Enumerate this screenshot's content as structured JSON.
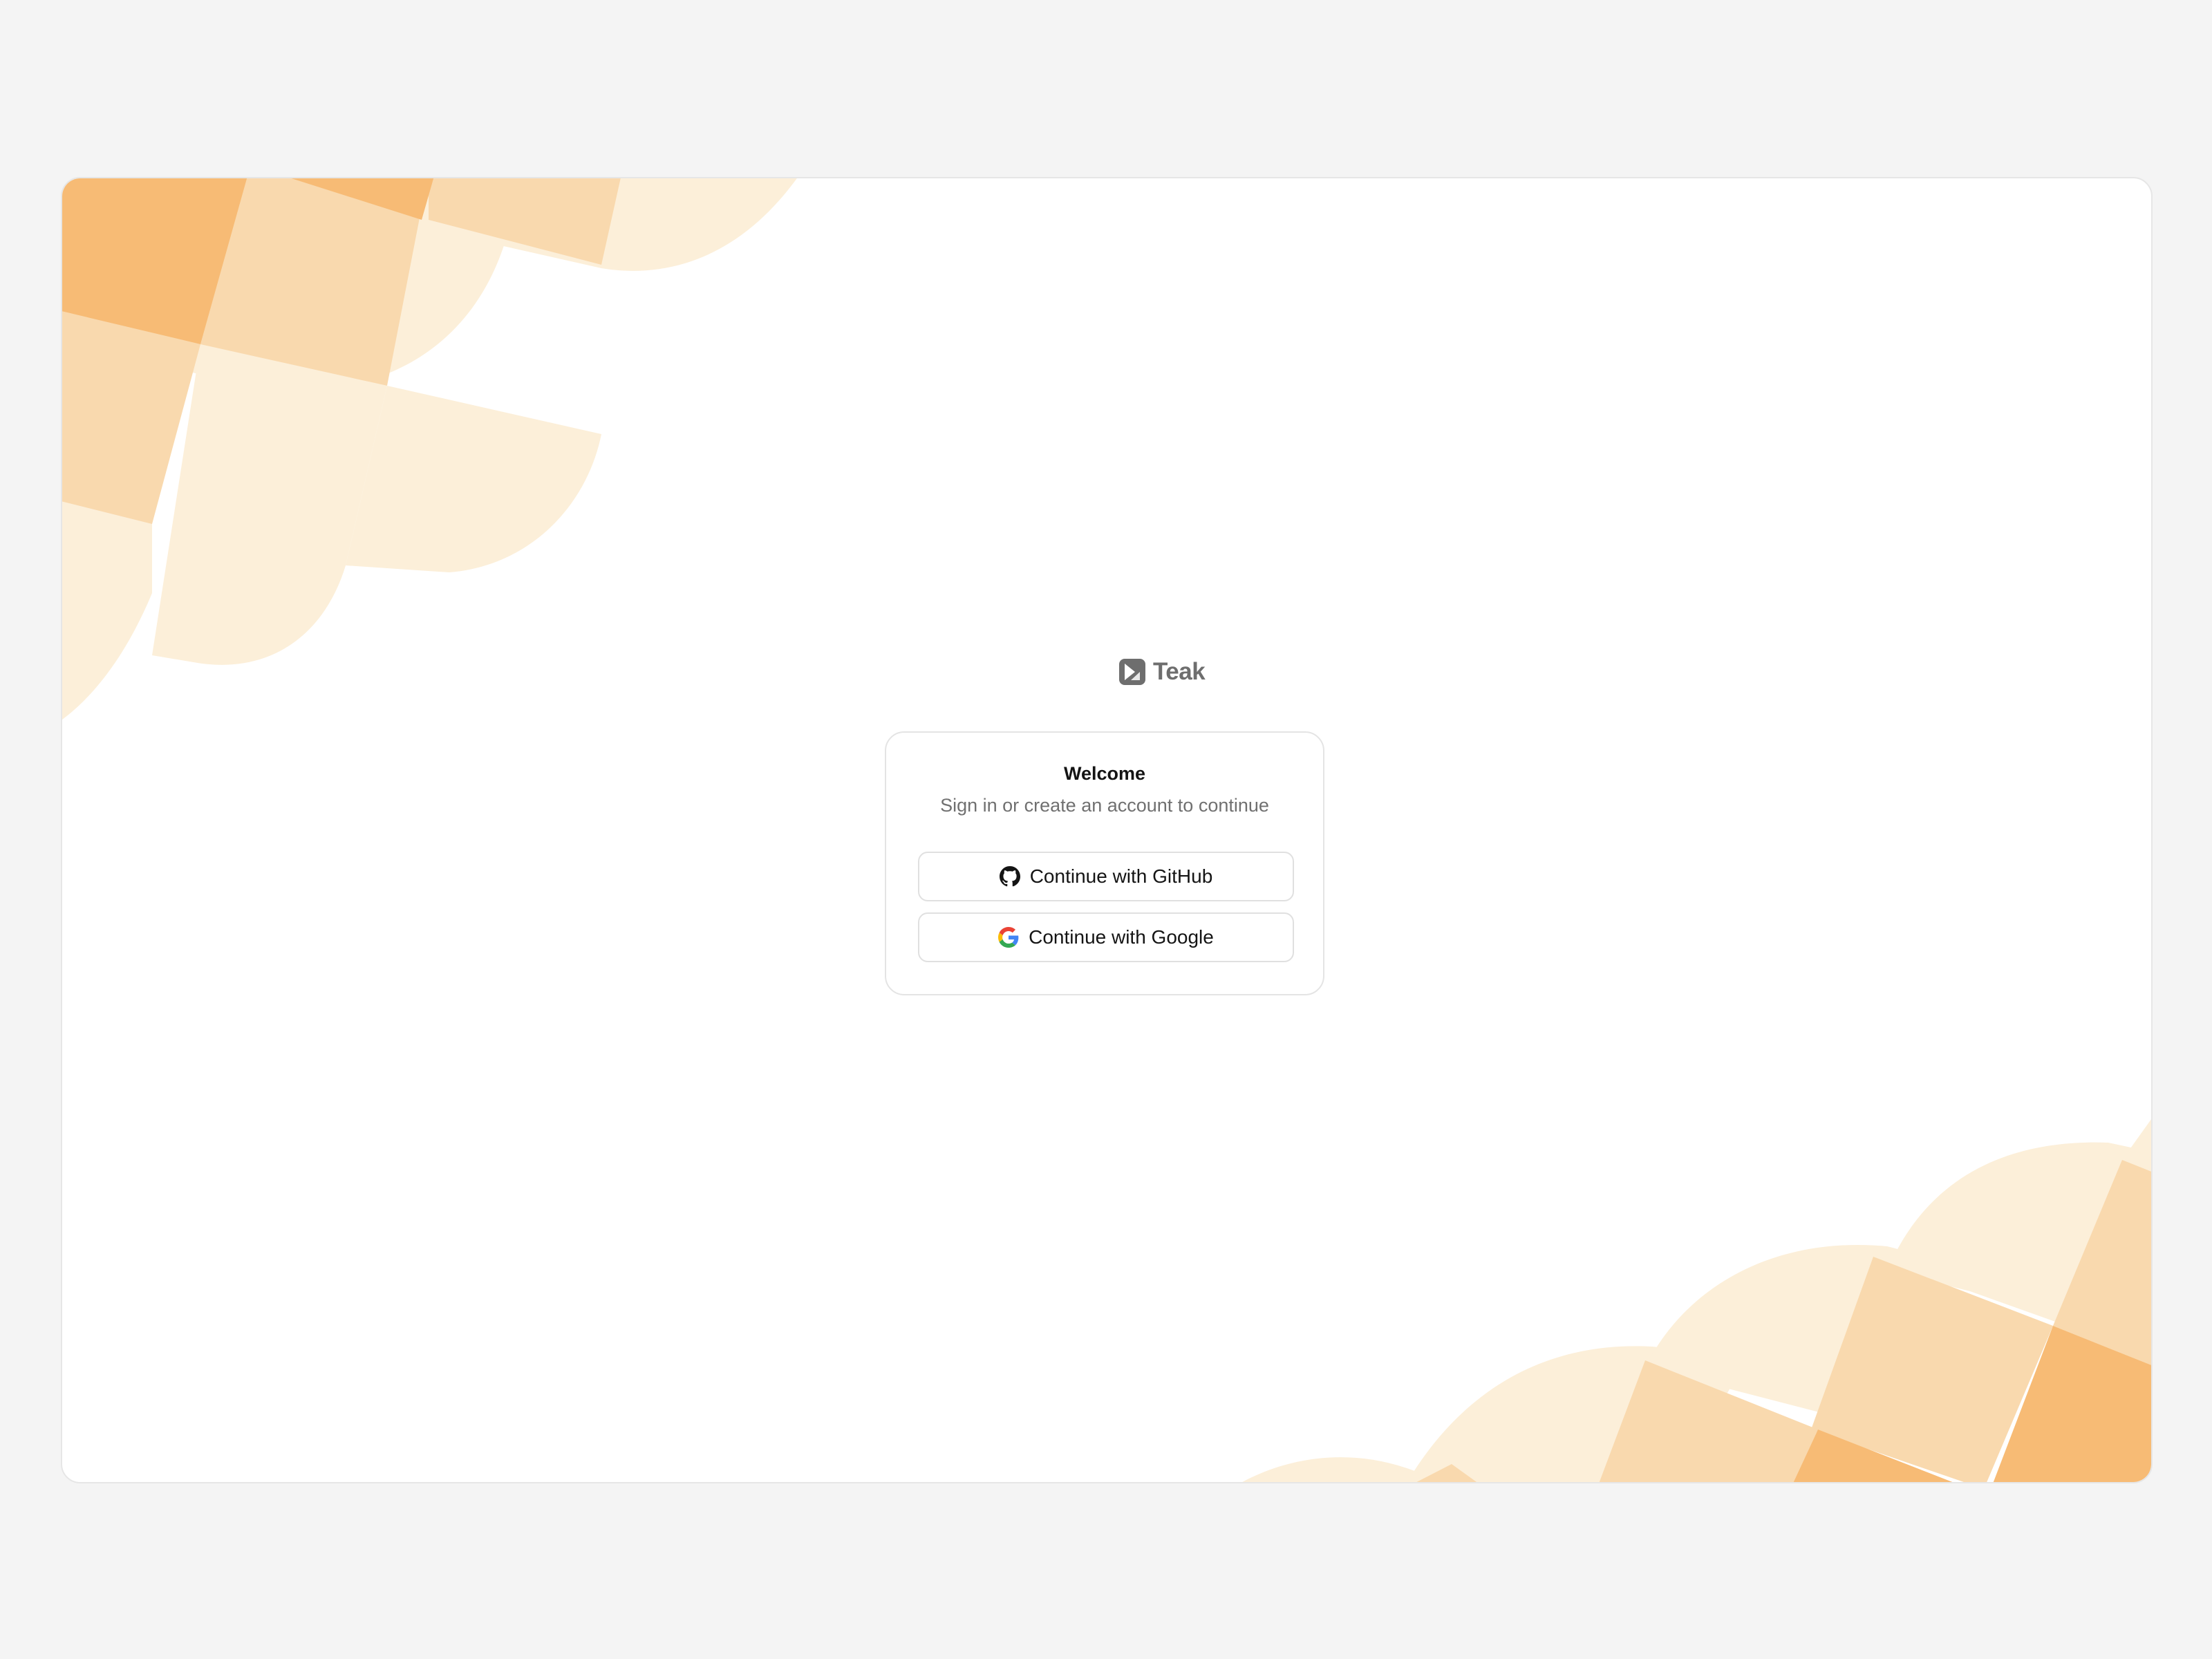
{
  "brand": {
    "name": "Teak",
    "logo_icon": "teak-logo-icon",
    "text_color": "#6e6e6e"
  },
  "auth_card": {
    "title": "Welcome",
    "subtitle": "Sign in or create an account to continue",
    "github_button": {
      "label": "Continue with GitHub",
      "icon": "github-icon"
    },
    "google_button": {
      "label": "Continue with Google",
      "icon": "google-icon"
    }
  },
  "theme": {
    "page_background": "#f4f4f4",
    "card_background": "#ffffff",
    "pattern_colors": [
      "#f7bb75",
      "#f9d9ae",
      "#fcefd9"
    ]
  }
}
